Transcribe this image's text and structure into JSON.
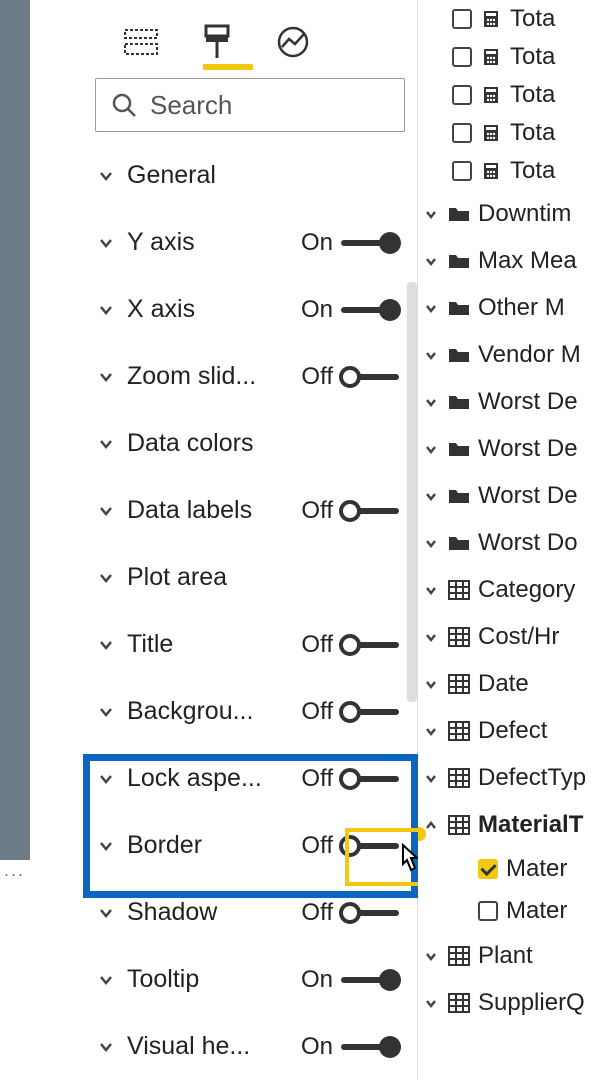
{
  "search": {
    "placeholder": "Search"
  },
  "format": {
    "rows": [
      {
        "key": "general",
        "label": "General",
        "toggle": null
      },
      {
        "key": "yaxis",
        "label": "Y axis",
        "toggle": "On"
      },
      {
        "key": "xaxis",
        "label": "X axis",
        "toggle": "On"
      },
      {
        "key": "zoom",
        "label": "Zoom slid...",
        "toggle": "Off"
      },
      {
        "key": "datacolors",
        "label": "Data colors",
        "toggle": null
      },
      {
        "key": "datalabels",
        "label": "Data labels",
        "toggle": "Off"
      },
      {
        "key": "plotarea",
        "label": "Plot area",
        "toggle": null
      },
      {
        "key": "title",
        "label": "Title",
        "toggle": "Off"
      },
      {
        "key": "background",
        "label": "Backgrou...",
        "toggle": "Off"
      },
      {
        "key": "lockaspect",
        "label": "Lock aspe...",
        "toggle": "Off"
      },
      {
        "key": "border",
        "label": "Border",
        "toggle": "Off"
      },
      {
        "key": "shadow",
        "label": "Shadow",
        "toggle": "Off"
      },
      {
        "key": "tooltip",
        "label": "Tooltip",
        "toggle": "On"
      },
      {
        "key": "visualhead",
        "label": "Visual he...",
        "toggle": "On"
      }
    ]
  },
  "fields": {
    "measures": [
      "Tota",
      "Tota",
      "Tota",
      "Tota",
      "Tota"
    ],
    "folders": [
      "Downtim",
      "Max Mea",
      "Other M",
      "Vendor M",
      "Worst De",
      "Worst De",
      "Worst De",
      "Worst Do"
    ],
    "tables": [
      {
        "label": "Category",
        "expanded": false
      },
      {
        "label": "Cost/Hr",
        "expanded": false
      },
      {
        "label": "Date",
        "expanded": false
      },
      {
        "label": "Defect",
        "expanded": false
      },
      {
        "label": "DefectTyp",
        "expanded": false
      },
      {
        "label": "MaterialT",
        "expanded": true,
        "bold": true,
        "badge": true,
        "children": [
          {
            "label": "Mater",
            "checked": true
          },
          {
            "label": "Mater",
            "checked": false
          }
        ]
      },
      {
        "label": "Plant",
        "expanded": false
      },
      {
        "label": "SupplierQ",
        "expanded": false
      }
    ]
  }
}
